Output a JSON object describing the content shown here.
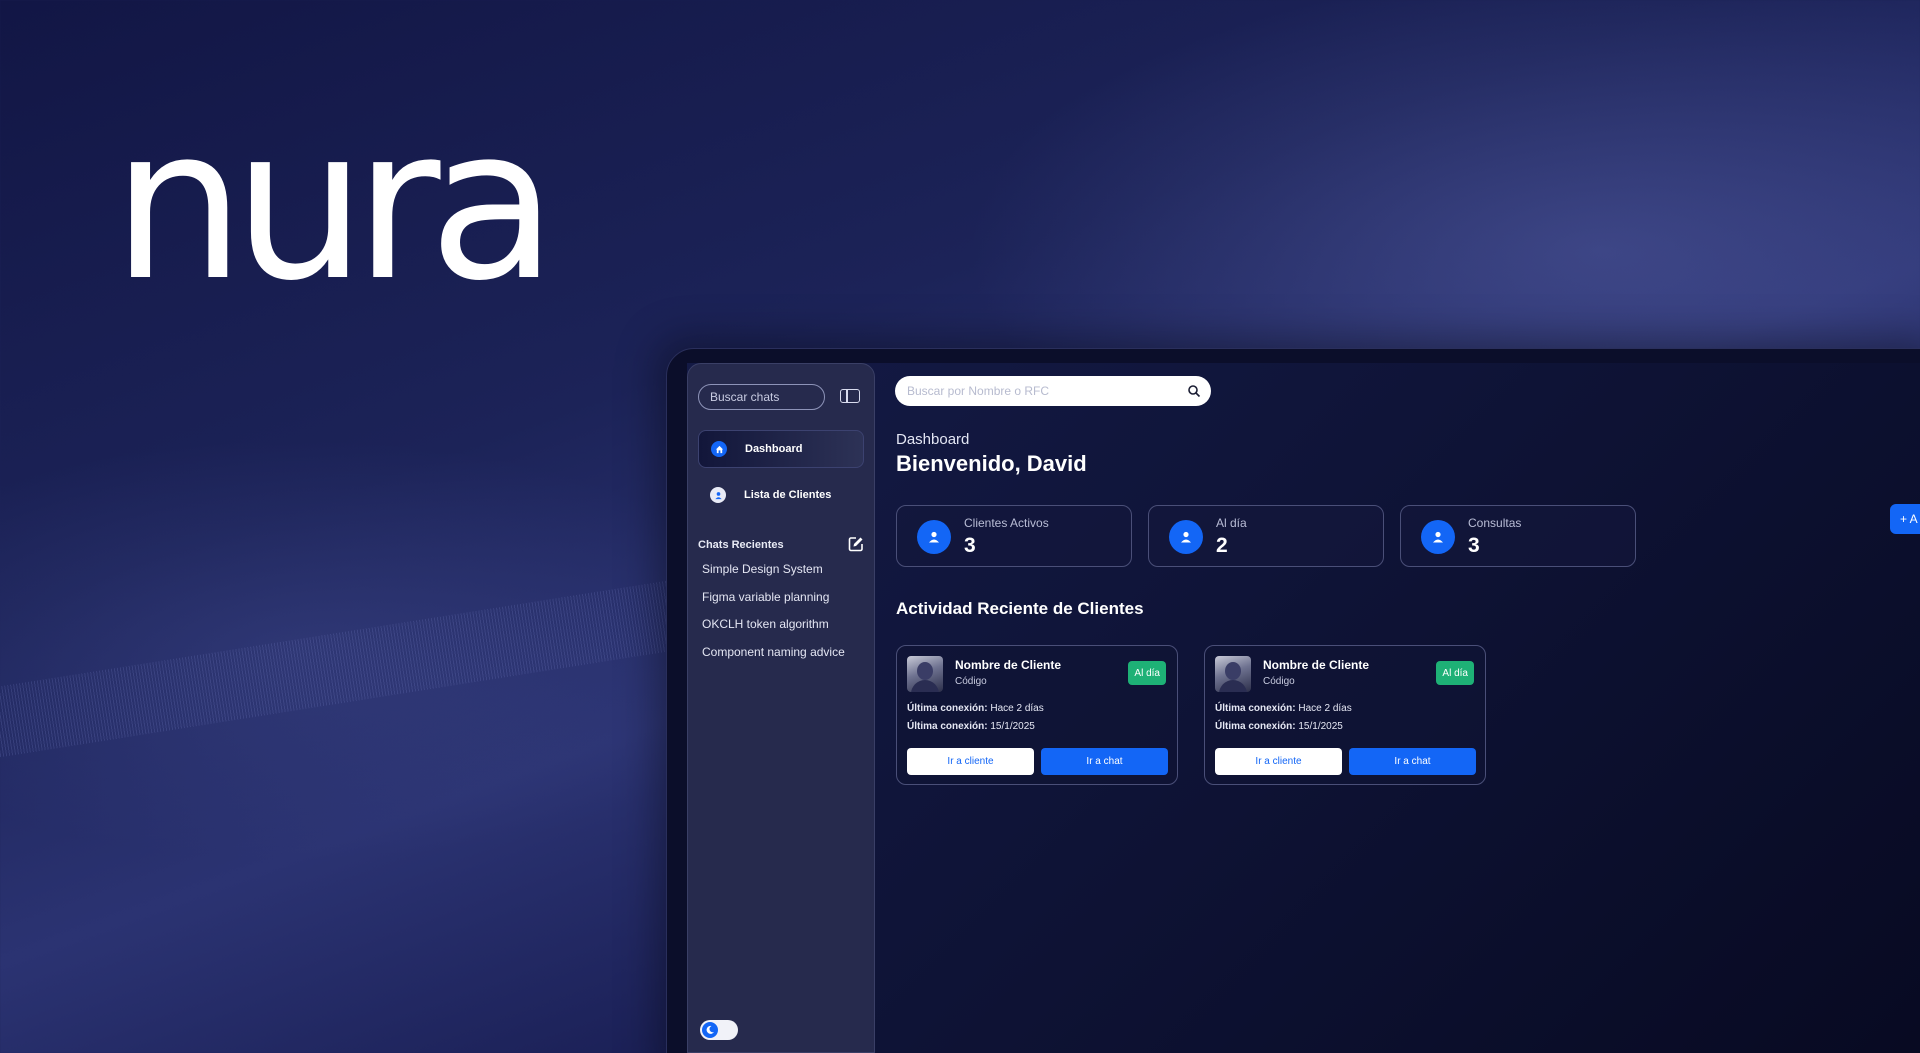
{
  "brand": {
    "logo_text": "nura"
  },
  "sidebar": {
    "search_placeholder": "Buscar chats",
    "nav": [
      {
        "label": "Dashboard",
        "icon": "home-icon",
        "active": true
      },
      {
        "label": "Lista de Clientes",
        "icon": "user-icon",
        "active": false
      }
    ],
    "recent_title": "Chats Recientes",
    "recent_chats": [
      "Simple Design System",
      "Figma variable planning",
      "OKCLH token algorithm",
      "Component naming advice"
    ],
    "theme_icon": "moon-icon"
  },
  "main": {
    "search_placeholder": "Buscar por Nombre o RFC",
    "kicker": "Dashboard",
    "title": "Bienvenido, David",
    "add_button_label": "+ A",
    "stats": [
      {
        "label": "Clientes Activos",
        "value": "3"
      },
      {
        "label": "Al día",
        "value": "2"
      },
      {
        "label": "Consultas",
        "value": "3"
      }
    ],
    "activity_title": "Actividad Reciente de Clientes",
    "clients": [
      {
        "name": "Nombre de Cliente",
        "code": "Código",
        "badge": "Al día",
        "meta1_label": "Última conexión:",
        "meta1_value": "Hace 2 días",
        "meta2_label": "Última conexión:",
        "meta2_value": "15/1/2025",
        "btn_client": "Ir a cliente",
        "btn_chat": "Ir a chat"
      },
      {
        "name": "Nombre de Cliente",
        "code": "Código",
        "badge": "Al día",
        "meta1_label": "Última conexión:",
        "meta1_value": "Hace 2 días",
        "meta2_label": "Última conexión:",
        "meta2_value": "15/1/2025",
        "btn_client": "Ir a cliente",
        "btn_chat": "Ir a chat"
      }
    ]
  },
  "colors": {
    "accent": "#1366f6",
    "success": "#1eb176",
    "sidebar_bg": "#262a4d",
    "background": "#1c2358"
  }
}
